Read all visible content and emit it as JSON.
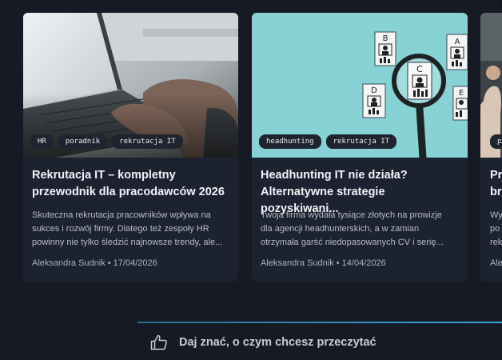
{
  "cards": [
    {
      "tags": [
        "HR",
        "poradnik",
        "rekrutacja IT"
      ],
      "title_line1": "Rekrutacja IT – kompletny",
      "title_line2": "przewodnik dla pracodawców 2026",
      "excerpt_line1": "Skuteczna rekrutacja pracowników wpływa na",
      "excerpt_line2": "sukces i rozwój firmy. Dlatego też zespoły HR",
      "excerpt_line3": "powinny nie tylko śledzić najnowsze trendy, ale...",
      "meta": "Aleksandra Sudnik • 17/04/2026"
    },
    {
      "tags": [
        "headhunting",
        "rekrutacja IT"
      ],
      "title_line1": "Headhunting IT nie działa?",
      "title_line2": "Alternatywne strategie pozyskiwani...",
      "excerpt_line1": "Twoja firma wydała tysiące złotych na prowizje",
      "excerpt_line2": "dla agencji headhunterskich, a w zamian",
      "excerpt_line3": "otrzymała garść niedopasowanych CV i serię...",
      "meta": "Aleksandra Sudnik • 14/04/2026",
      "illustration_letters": [
        "B",
        "A",
        "C",
        "D",
        "E"
      ]
    },
    {
      "tags": [
        "p"
      ],
      "title_line1": "Pr",
      "title_line2": "br",
      "excerpt_line1": "Wy",
      "excerpt_line2": "po",
      "excerpt_line3": "rek",
      "meta": "Ale"
    }
  ],
  "feedback": {
    "icon": "thumbs-up-icon",
    "label": "Daj znać, o czym chcesz przeczytać"
  },
  "colors": {
    "background": "#131722",
    "card": "#1d2230",
    "accent_line": "#3aa6d6",
    "illustration_bg": "#86d2d4"
  }
}
